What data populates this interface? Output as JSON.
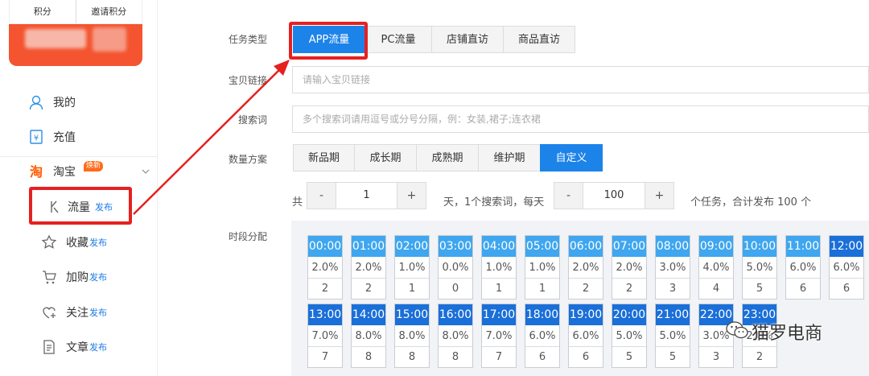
{
  "sidebar": {
    "card": {
      "points_label": "积分",
      "invite_label": "邀请积分"
    },
    "items": {
      "mine": "我的",
      "recharge": "充值",
      "taobao": "淘宝",
      "taobao_badge": "焕新",
      "traffic": "流量",
      "traffic_tag": "发布",
      "favorite": "收藏",
      "favorite_tag": "发布",
      "cart": "加购",
      "cart_tag": "发布",
      "follow": "关注",
      "follow_tag": "发布",
      "article": "文章",
      "article_tag": "发布"
    }
  },
  "form": {
    "task_type_label": "任务类型",
    "task_types": [
      "APP流量",
      "PC流量",
      "店铺直访",
      "商品直访"
    ],
    "link_label": "宝贝链接",
    "link_placeholder": "请输入宝贝链接",
    "keyword_label": "搜索词",
    "keyword_placeholder": "多个搜索词请用逗号或分号分隔，例：女装,裙子;连衣裙",
    "plan_label": "数量方案",
    "plans": [
      "新品期",
      "成长期",
      "成熟期",
      "维护期",
      "自定义"
    ],
    "days_prefix": "共",
    "days_value": "1",
    "mid_text": "天，1个搜索词，每天",
    "per_day_value": "100",
    "summary_text": "个任务，合计发布 100 个",
    "minus": "-",
    "plus": "+",
    "slot_label": "时段分配"
  },
  "slots": [
    {
      "time": "00:00",
      "pct": "2.0%",
      "n": "2",
      "style": "light"
    },
    {
      "time": "01:00",
      "pct": "2.0%",
      "n": "2",
      "style": "light"
    },
    {
      "time": "02:00",
      "pct": "1.0%",
      "n": "1",
      "style": "light"
    },
    {
      "time": "03:00",
      "pct": "0.0%",
      "n": "0",
      "style": "light"
    },
    {
      "time": "04:00",
      "pct": "1.0%",
      "n": "1",
      "style": "light"
    },
    {
      "time": "05:00",
      "pct": "1.0%",
      "n": "1",
      "style": "light"
    },
    {
      "time": "06:00",
      "pct": "2.0%",
      "n": "2",
      "style": "light"
    },
    {
      "time": "07:00",
      "pct": "2.0%",
      "n": "2",
      "style": "light"
    },
    {
      "time": "08:00",
      "pct": "3.0%",
      "n": "3",
      "style": "light"
    },
    {
      "time": "09:00",
      "pct": "4.0%",
      "n": "4",
      "style": "light"
    },
    {
      "time": "10:00",
      "pct": "5.0%",
      "n": "5",
      "style": "light"
    },
    {
      "time": "11:00",
      "pct": "6.0%",
      "n": "6",
      "style": "light"
    },
    {
      "time": "12:00",
      "pct": "6.0%",
      "n": "6",
      "style": "dark"
    },
    {
      "time": "13:00",
      "pct": "7.0%",
      "n": "7",
      "style": "dark"
    },
    {
      "time": "14:00",
      "pct": "8.0%",
      "n": "8",
      "style": "dark"
    },
    {
      "time": "15:00",
      "pct": "8.0%",
      "n": "8",
      "style": "dark"
    },
    {
      "time": "16:00",
      "pct": "8.0%",
      "n": "8",
      "style": "dark"
    },
    {
      "time": "17:00",
      "pct": "7.0%",
      "n": "7",
      "style": "dark"
    },
    {
      "time": "18:00",
      "pct": "6.0%",
      "n": "6",
      "style": "dark"
    },
    {
      "time": "19:00",
      "pct": "6.0%",
      "n": "6",
      "style": "dark"
    },
    {
      "time": "20:00",
      "pct": "5.0%",
      "n": "5",
      "style": "dark"
    },
    {
      "time": "21:00",
      "pct": "5.0%",
      "n": "5",
      "style": "dark"
    },
    {
      "time": "22:00",
      "pct": "3.0%",
      "n": "3",
      "style": "dark"
    },
    {
      "time": "23:00",
      "pct": "2.0%",
      "n": "2",
      "style": "dark"
    }
  ],
  "watermark": {
    "text": "猫罗电商"
  },
  "colors": {
    "primary": "#1c83e9",
    "slot_light": "#3fa6ef",
    "slot_dark": "#1a6fd8",
    "highlight": "#e5211f",
    "card": "#f4542f"
  }
}
